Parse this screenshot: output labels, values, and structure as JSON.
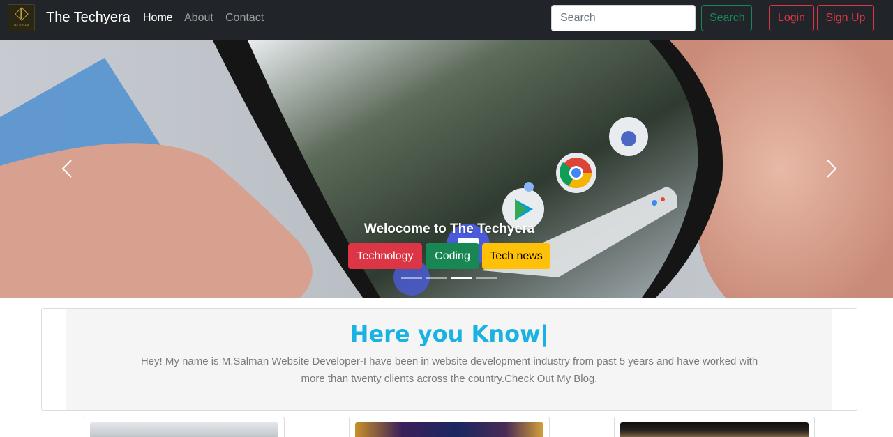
{
  "navbar": {
    "logo_text": "TECHYERA",
    "brand": "The Techyera",
    "links": [
      "Home",
      "About",
      "Contact"
    ],
    "active_link": "Home",
    "search_placeholder": "Search",
    "search_button": "Search",
    "login_button": "Login",
    "signup_button": "Sign Up"
  },
  "carousel": {
    "caption": "Welocome to The Techyera",
    "tags": [
      "Technology",
      "Coding",
      "Tech news"
    ],
    "slide_count": 4,
    "active_slide": 3,
    "prev_icon": "chevron-left-icon",
    "next_icon": "chevron-right-icon"
  },
  "intro": {
    "heading": "Here you Know|",
    "text": "Hey! My name is M.Salman Website Developer-I have been in website development industry from past 5 years and have worked with more than twenty clients across the country.Check Out My Blog."
  },
  "colors": {
    "navbar_bg": "#212529",
    "success": "#198754",
    "danger": "#dc3545",
    "warning": "#ffc107",
    "heading_accent": "#1ab2e2"
  }
}
